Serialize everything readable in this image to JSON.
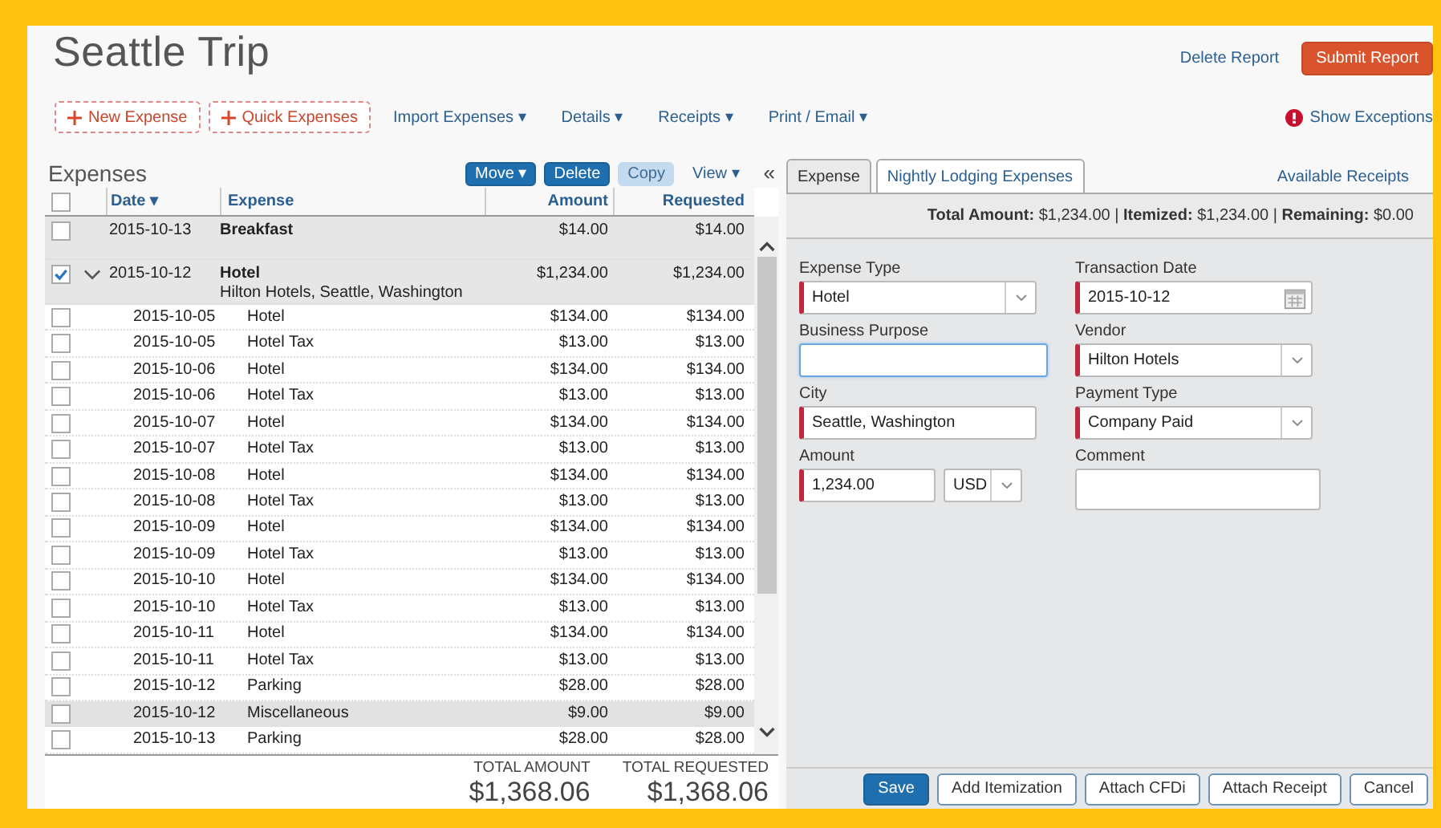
{
  "report": {
    "title": "Seattle Trip",
    "delete_link": "Delete Report",
    "submit_button": "Submit Report"
  },
  "toolbar": {
    "buttons": [
      {
        "label": "New Expense"
      },
      {
        "label": "Quick Expenses"
      }
    ],
    "menus": [
      "Import Expenses ▾",
      "Details ▾",
      "Receipts ▾",
      "Print / Email ▾"
    ],
    "exceptions_link": "Show Exceptions"
  },
  "expenses": {
    "title": "Expenses",
    "actions": [
      {
        "label": "Move ▾",
        "kind": "primary",
        "disabled": false
      },
      {
        "label": "Delete",
        "kind": "primary",
        "disabled": false
      },
      {
        "label": "Copy",
        "kind": "primary",
        "disabled": true
      },
      {
        "label": "View ▾",
        "kind": "link",
        "disabled": false
      }
    ],
    "collapse": "«",
    "header_checked": false,
    "columns": [
      "Date ▾",
      "Expense",
      "Amount",
      "Requested"
    ],
    "rows": [
      {
        "date": "2015-10-13",
        "expense": "Breakfast",
        "amount": "$14.00",
        "requested": "$14.00",
        "checked": false
      },
      {
        "date": "2015-10-12",
        "expense": "Hotel",
        "subtitle": "Hilton Hotels, Seattle, Washington",
        "amount": "$1,234.00",
        "requested": "$1,234.00",
        "checked": true,
        "expanded": true,
        "children": [
          {
            "date": "2015-10-05",
            "expense": "Hotel",
            "amount": "$134.00",
            "requested": "$134.00",
            "checked": false,
            "selected": false
          },
          {
            "date": "2015-10-05",
            "expense": "Hotel Tax",
            "amount": "$13.00",
            "requested": "$13.00",
            "checked": false,
            "selected": false
          },
          {
            "date": "2015-10-06",
            "expense": "Hotel",
            "amount": "$134.00",
            "requested": "$134.00",
            "checked": false,
            "selected": false
          },
          {
            "date": "2015-10-06",
            "expense": "Hotel Tax",
            "amount": "$13.00",
            "requested": "$13.00",
            "checked": false,
            "selected": false
          },
          {
            "date": "2015-10-07",
            "expense": "Hotel",
            "amount": "$134.00",
            "requested": "$134.00",
            "checked": false,
            "selected": false
          },
          {
            "date": "2015-10-07",
            "expense": "Hotel Tax",
            "amount": "$13.00",
            "requested": "$13.00",
            "checked": false,
            "selected": false
          },
          {
            "date": "2015-10-08",
            "expense": "Hotel",
            "amount": "$134.00",
            "requested": "$134.00",
            "checked": false,
            "selected": false
          },
          {
            "date": "2015-10-08",
            "expense": "Hotel Tax",
            "amount": "$13.00",
            "requested": "$13.00",
            "checked": false,
            "selected": false
          },
          {
            "date": "2015-10-09",
            "expense": "Hotel",
            "amount": "$134.00",
            "requested": "$134.00",
            "checked": false,
            "selected": false
          },
          {
            "date": "2015-10-09",
            "expense": "Hotel Tax",
            "amount": "$13.00",
            "requested": "$13.00",
            "checked": false,
            "selected": false
          },
          {
            "date": "2015-10-10",
            "expense": "Hotel",
            "amount": "$134.00",
            "requested": "$134.00",
            "checked": false,
            "selected": false
          },
          {
            "date": "2015-10-10",
            "expense": "Hotel Tax",
            "amount": "$13.00",
            "requested": "$13.00",
            "checked": false,
            "selected": false
          },
          {
            "date": "2015-10-11",
            "expense": "Hotel",
            "amount": "$134.00",
            "requested": "$134.00",
            "checked": false,
            "selected": false
          },
          {
            "date": "2015-10-11",
            "expense": "Hotel Tax",
            "amount": "$13.00",
            "requested": "$13.00",
            "checked": false,
            "selected": false
          },
          {
            "date": "2015-10-12",
            "expense": "Parking",
            "amount": "$28.00",
            "requested": "$28.00",
            "checked": false,
            "selected": false
          },
          {
            "date": "2015-10-12",
            "expense": "Miscellaneous",
            "amount": "$9.00",
            "requested": "$9.00",
            "checked": false,
            "selected": true
          },
          {
            "date": "2015-10-13",
            "expense": "Parking",
            "amount": "$28.00",
            "requested": "$28.00",
            "checked": false,
            "selected": false
          }
        ]
      }
    ],
    "totals": [
      {
        "label": "TOTAL AMOUNT",
        "value": "$1,368.06"
      },
      {
        "label": "TOTAL REQUESTED",
        "value": "$1,368.06"
      }
    ]
  },
  "detail": {
    "tabs": [
      {
        "label": "Expense",
        "selected": true
      },
      {
        "label": "Nightly Lodging Expenses",
        "selected": false
      }
    ],
    "receipts_link": "Available Receipts",
    "summary": "**Total Amount:** $1,234.00 | **Itemized:** $1,234.00 | **Remaining:** $0.00",
    "fields": [
      {
        "label": "Expense Type",
        "kind": "select",
        "value": "Hotel",
        "required": true,
        "focused": false
      },
      {
        "label": "Transaction Date",
        "kind": "date",
        "value": "2015-10-12",
        "required": true,
        "focused": false
      },
      {
        "label": "Business Purpose",
        "kind": "text",
        "required": false,
        "focused": true
      },
      {
        "label": "Vendor",
        "kind": "select",
        "value": "Hilton Hotels",
        "required": true,
        "focused": false
      },
      {
        "label": "City",
        "kind": "text",
        "value": "Seattle, Washington",
        "required": true,
        "focused": false
      },
      {
        "label": "Payment Type",
        "kind": "select",
        "value": "Company Paid",
        "required": true,
        "focused": false
      },
      {
        "label": "Amount",
        "kind": "amount",
        "value": "1,234.00",
        "currency": "USD",
        "required": true,
        "focused": false
      },
      {
        "label": "Comment",
        "kind": "textarea",
        "required": false,
        "focused": false
      }
    ],
    "buttons": [
      {
        "label": "Save",
        "kind": "primary"
      },
      {
        "label": "Add Itemization",
        "kind": "default"
      },
      {
        "label": "Attach CFDi",
        "kind": "default"
      },
      {
        "label": "Attach Receipt",
        "kind": "default"
      },
      {
        "label": "Cancel",
        "kind": "default"
      }
    ]
  }
}
